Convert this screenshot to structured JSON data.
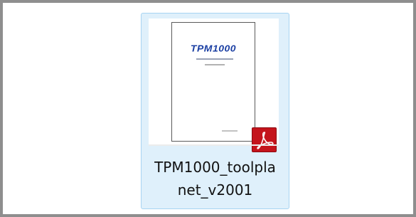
{
  "file": {
    "name_line1": "TPM1000_toolpla",
    "name_line2": "net_v2001",
    "icon": "pdf-file-icon",
    "selected": true
  },
  "thumbnail": {
    "logo_text": "TPM1000"
  },
  "colors": {
    "selection_fill": "#dff0fb",
    "selection_border": "#a7d4f2",
    "pdf_badge": "#c4141c",
    "logo": "#1b3fa3",
    "frame_border": "#8e8e8e"
  }
}
